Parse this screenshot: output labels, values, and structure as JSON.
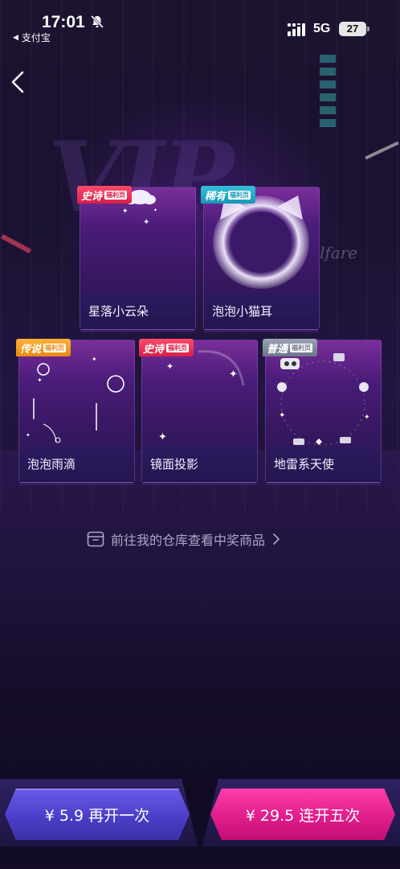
{
  "status_bar": {
    "time": "17:01",
    "back_app": "支付宝",
    "network": "5G",
    "battery": "27"
  },
  "icons": {
    "back": "chevron-left-icon",
    "mute": "bell-slash-icon",
    "signal": "signal-bars-icon",
    "warehouse": "box-icon",
    "link_arrow": "chevron-right-icon"
  },
  "prizes": [
    {
      "name": "星落小云朵",
      "rarity": "史诗",
      "tag": "福利页",
      "badge_color": "#d7204a"
    },
    {
      "name": "泡泡小猫耳",
      "rarity": "稀有",
      "tag": "福利页",
      "badge_color": "#1896b6"
    },
    {
      "name": "泡泡雨滴",
      "rarity": "传说",
      "tag": "福利页",
      "badge_color": "#e98a10"
    },
    {
      "name": "镜面投影",
      "rarity": "史诗",
      "tag": "福利页",
      "badge_color": "#d7204a"
    },
    {
      "name": "地雷系天使",
      "rarity": "普通",
      "tag": "福利页",
      "badge_color": "#6d7588"
    }
  ],
  "warehouse_link": "前往我的仓库查看中奖商品",
  "buttons": {
    "once": "¥ 5.9 再开一次",
    "five": "¥ 29.5 连开五次"
  },
  "colors": {
    "once_button": "#4b3ec8",
    "five_button": "#e01e8c",
    "background": "#1a1230"
  }
}
